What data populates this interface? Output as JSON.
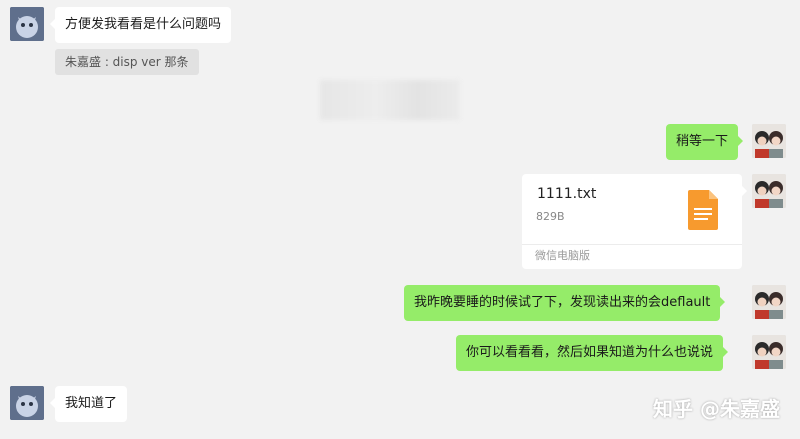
{
  "messages": {
    "m1_text": "方便发我看看是什么问题吗",
    "quote_text": "朱嘉盛 : disp ver 那条",
    "m2_text": "稍等一下",
    "file": {
      "name": "1111.txt",
      "size": "829B",
      "source": "微信电脑版",
      "icon": "document-icon"
    },
    "m3_text": "我昨晚要睡的时候试了下，发现读出来的会deflault",
    "m4_text": "你可以看看看，然后如果知道为什么也说说",
    "m5_text": "我知道了"
  },
  "watermark": "知乎 @朱嘉盛",
  "colors": {
    "background": "#f2f2f2",
    "bubble_self": "#95ec69",
    "bubble_other": "#ffffff",
    "file_icon": "#f79a2e"
  }
}
